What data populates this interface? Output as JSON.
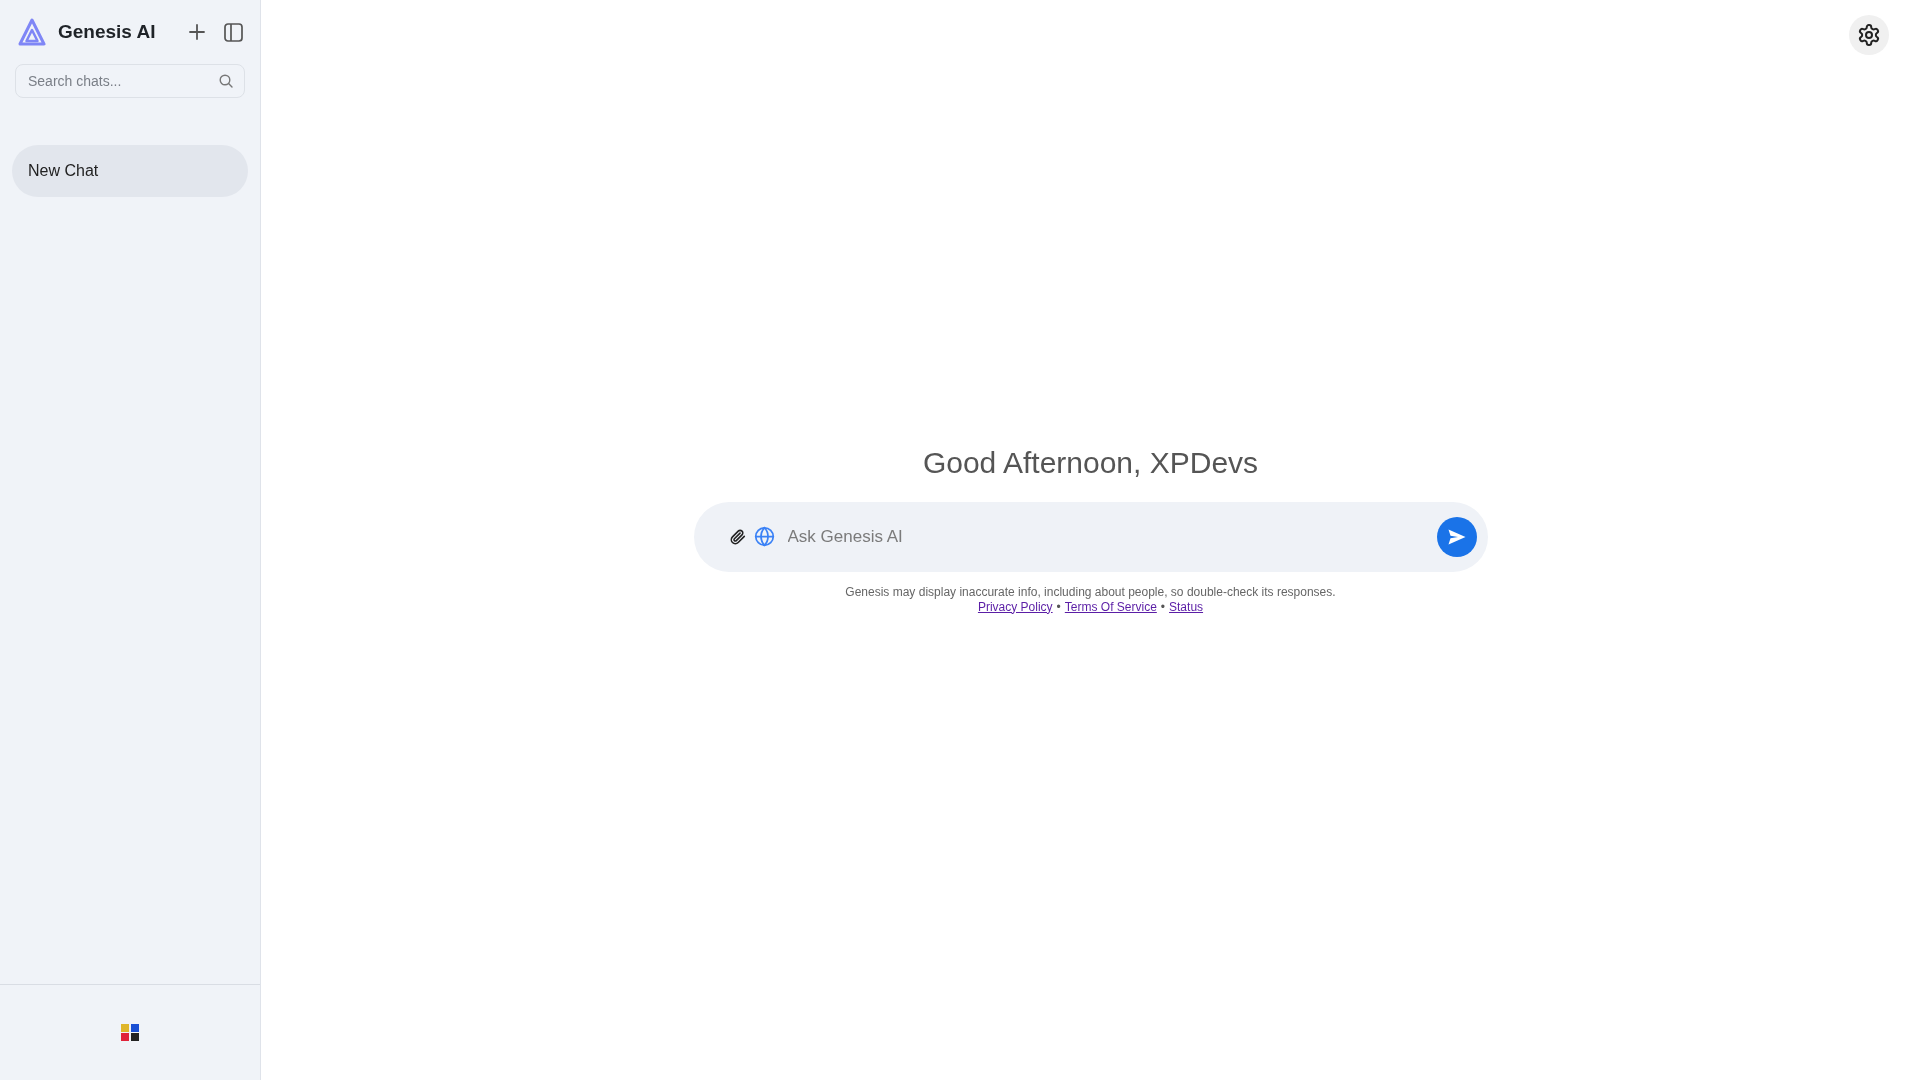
{
  "sidebar": {
    "brand": "Genesis AI",
    "search": {
      "placeholder": "Search chats..."
    },
    "chats": [
      {
        "title": "New Chat",
        "selected": true
      }
    ]
  },
  "main": {
    "greeting": "Good Afternoon, XPDevs",
    "composer": {
      "placeholder": "Ask Genesis AI"
    },
    "disclaimer": "Genesis may display inaccurate info, including about people, so double-check its responses.",
    "footer": [
      {
        "kind": "link",
        "text": "Privacy Policy"
      },
      {
        "kind": "separator",
        "text": "•"
      },
      {
        "kind": "link",
        "text": "Terms Of Service"
      },
      {
        "kind": "separator",
        "text": "•"
      },
      {
        "kind": "link",
        "text": "Status"
      }
    ]
  }
}
